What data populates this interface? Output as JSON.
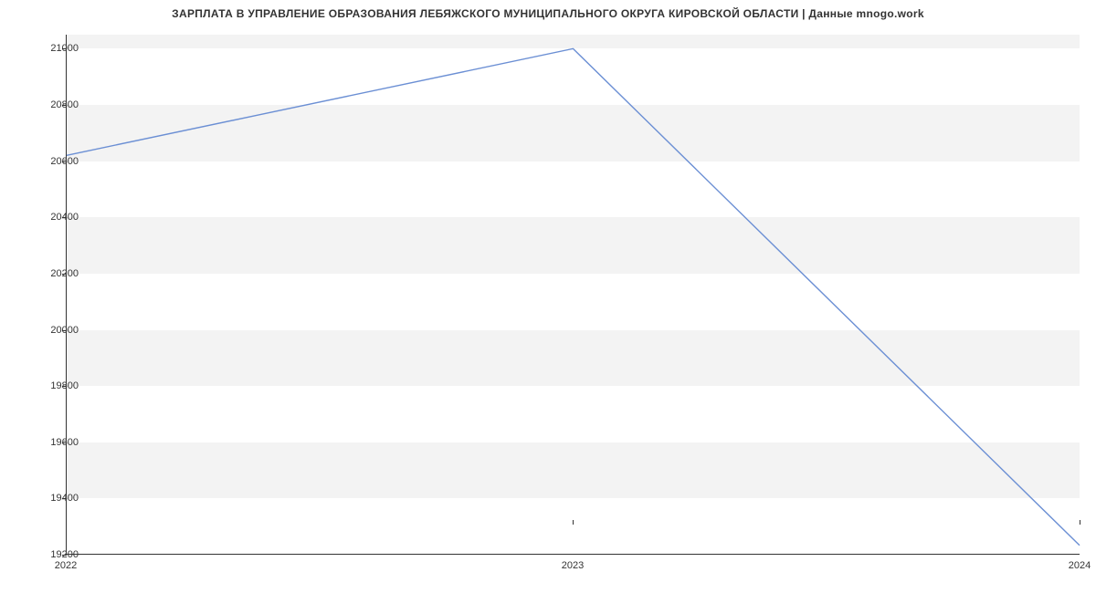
{
  "chart_data": {
    "type": "line",
    "title": "ЗАРПЛАТА В УПРАВЛЕНИЕ ОБРАЗОВАНИЯ  ЛЕБЯЖСКОГО МУНИЦИПАЛЬНОГО ОКРУГА КИРОВСКОЙ ОБЛАСТИ | Данные mnogo.work",
    "x": [
      2022,
      2023,
      2024
    ],
    "values": [
      20620,
      21000,
      19230
    ],
    "xlabel": "",
    "ylabel": "",
    "xticks": [
      "2022",
      "2023",
      "2024"
    ],
    "yticks": [
      19200,
      19400,
      19600,
      19800,
      20000,
      20200,
      20400,
      20600,
      20800,
      21000
    ],
    "ylim": [
      19200,
      21050
    ],
    "xlim": [
      2022,
      2024
    ]
  }
}
